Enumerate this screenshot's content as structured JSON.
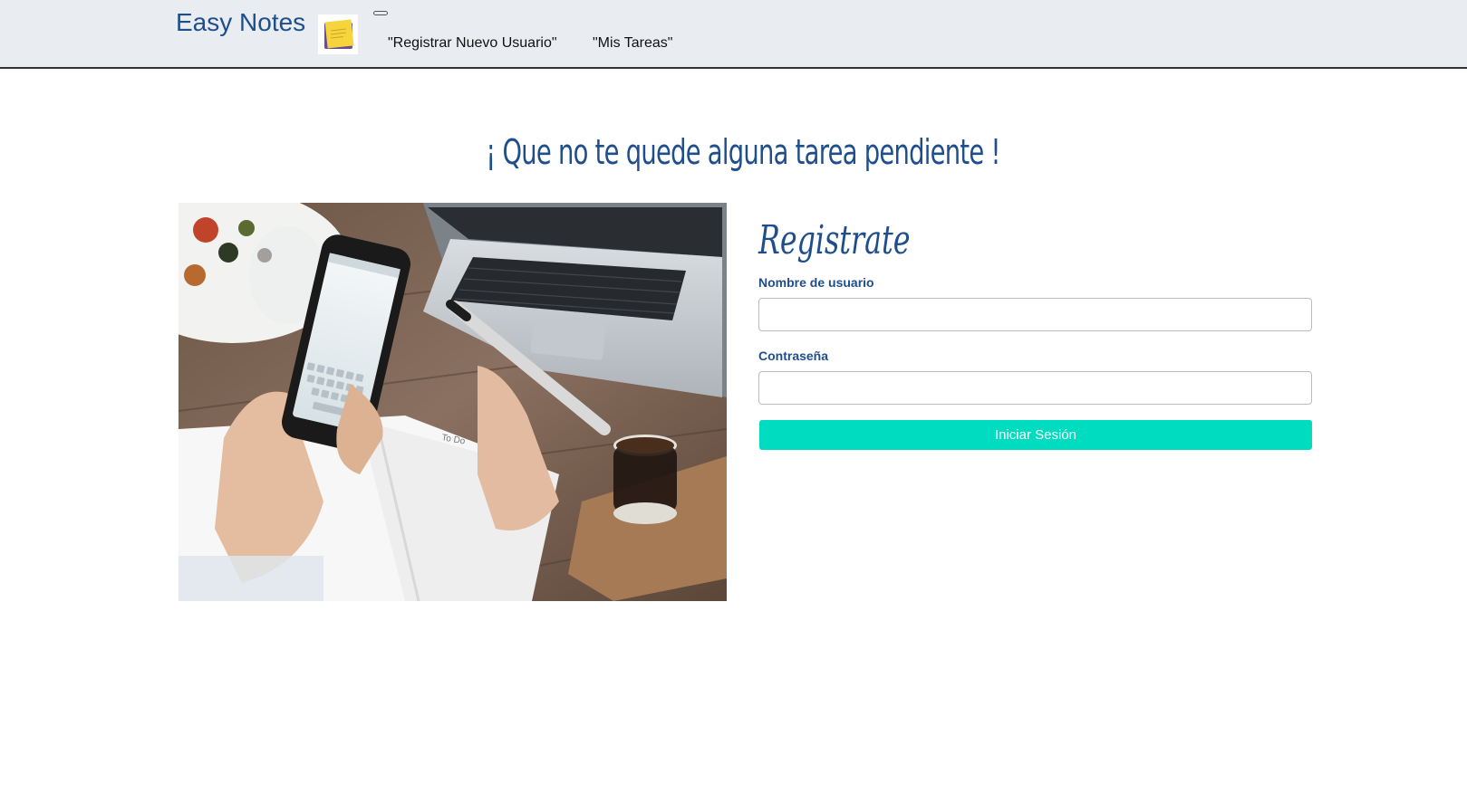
{
  "navbar": {
    "brand": "Easy Notes",
    "logo_icon": "sticky-note-icon",
    "toggler_icon": "menu-toggle-icon",
    "links": [
      {
        "label": "\"Registrar Nuevo Usuario\""
      },
      {
        "label": "\"Mis Tareas\""
      }
    ]
  },
  "main": {
    "tagline": "¡ Que no te quede alguna tarea pendiente !",
    "hero_image": "phone-notebook-laptop-photo"
  },
  "form": {
    "title": "Registrate",
    "username_label": "Nombre de usuario",
    "username_value": "",
    "password_label": "Contraseña",
    "password_value": "",
    "submit_label": "Iniciar Sesión"
  },
  "colors": {
    "brand_blue": "#1f4e8c",
    "navbar_bg": "#e9edf1",
    "button_teal": "#00dcc0"
  }
}
